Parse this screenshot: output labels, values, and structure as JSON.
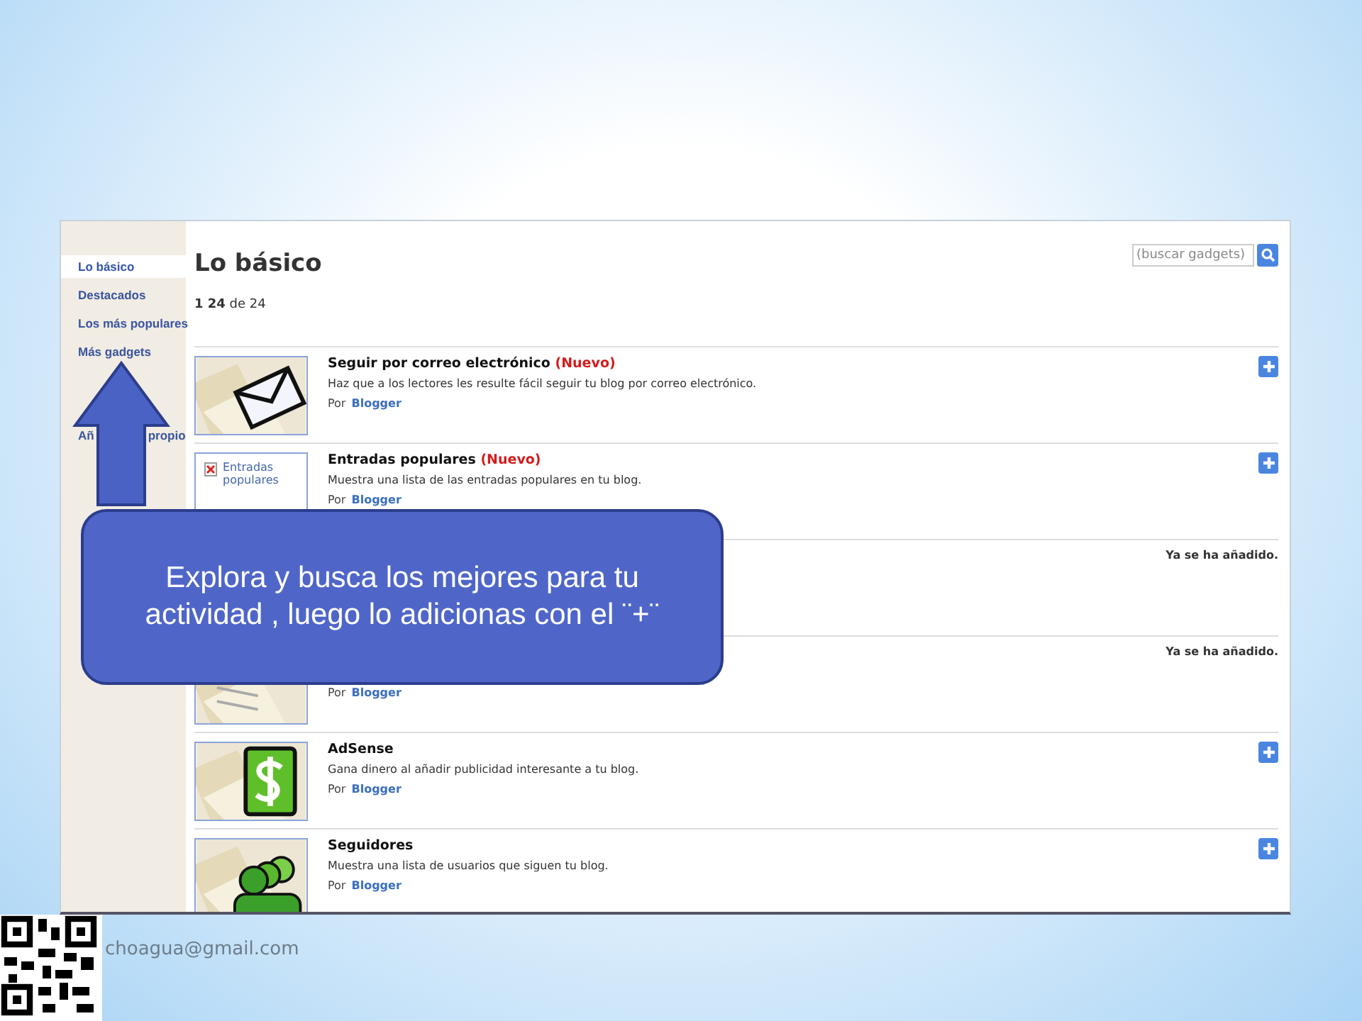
{
  "sidebar": {
    "items": [
      {
        "label": "Lo básico",
        "selected": true
      },
      {
        "label": "Destacados",
        "selected": false
      },
      {
        "label": "Los más populares",
        "selected": false
      },
      {
        "label": "Más gadgets",
        "selected": false
      }
    ],
    "custom_link": {
      "label_start": "Añ",
      "label_end": "propio"
    }
  },
  "header": {
    "title": "Lo básico",
    "search": {
      "placeholder": "(buscar gadgets)"
    },
    "pagination": "**1 24** de 24"
  },
  "gadgets": [
    {
      "kind": "envelope",
      "title": "Seguir por correo electrónico",
      "badge": "(Nuevo)",
      "description": "Haz que a los lectores les resulte fácil seguir tu blog por correo electrónico.",
      "by": "Por",
      "author": "Blogger",
      "added": false
    },
    {
      "kind": "broken",
      "thumbnail_label": "Entradas populares",
      "title": "Entradas populares",
      "badge": "(Nuevo)",
      "description": "Muestra una lista de las entradas populares en tu blog.",
      "by": "Por",
      "author": "Blogger",
      "added": false
    },
    {
      "kind": "hidden",
      "added": true,
      "status": "Ya se ha añadido."
    },
    {
      "kind": "page",
      "by": "Por",
      "author": "Blogger",
      "added": true,
      "status": "Ya se ha añadido."
    },
    {
      "kind": "dollar",
      "title": "AdSense",
      "description": "Gana dinero al añadir publicidad interesante a tu blog.",
      "by": "Por",
      "author": "Blogger",
      "added": false
    },
    {
      "kind": "people",
      "title": "Seguidores",
      "description": "Muestra una lista de usuarios que siguen tu blog.",
      "by": "Por",
      "author": "Blogger",
      "added": false
    }
  ],
  "callout": {
    "text": "Explora y busca los mejores para tu actividad , luego lo adicionas con el ¨+¨"
  },
  "footer": {
    "email": "choagua@gmail.com"
  }
}
